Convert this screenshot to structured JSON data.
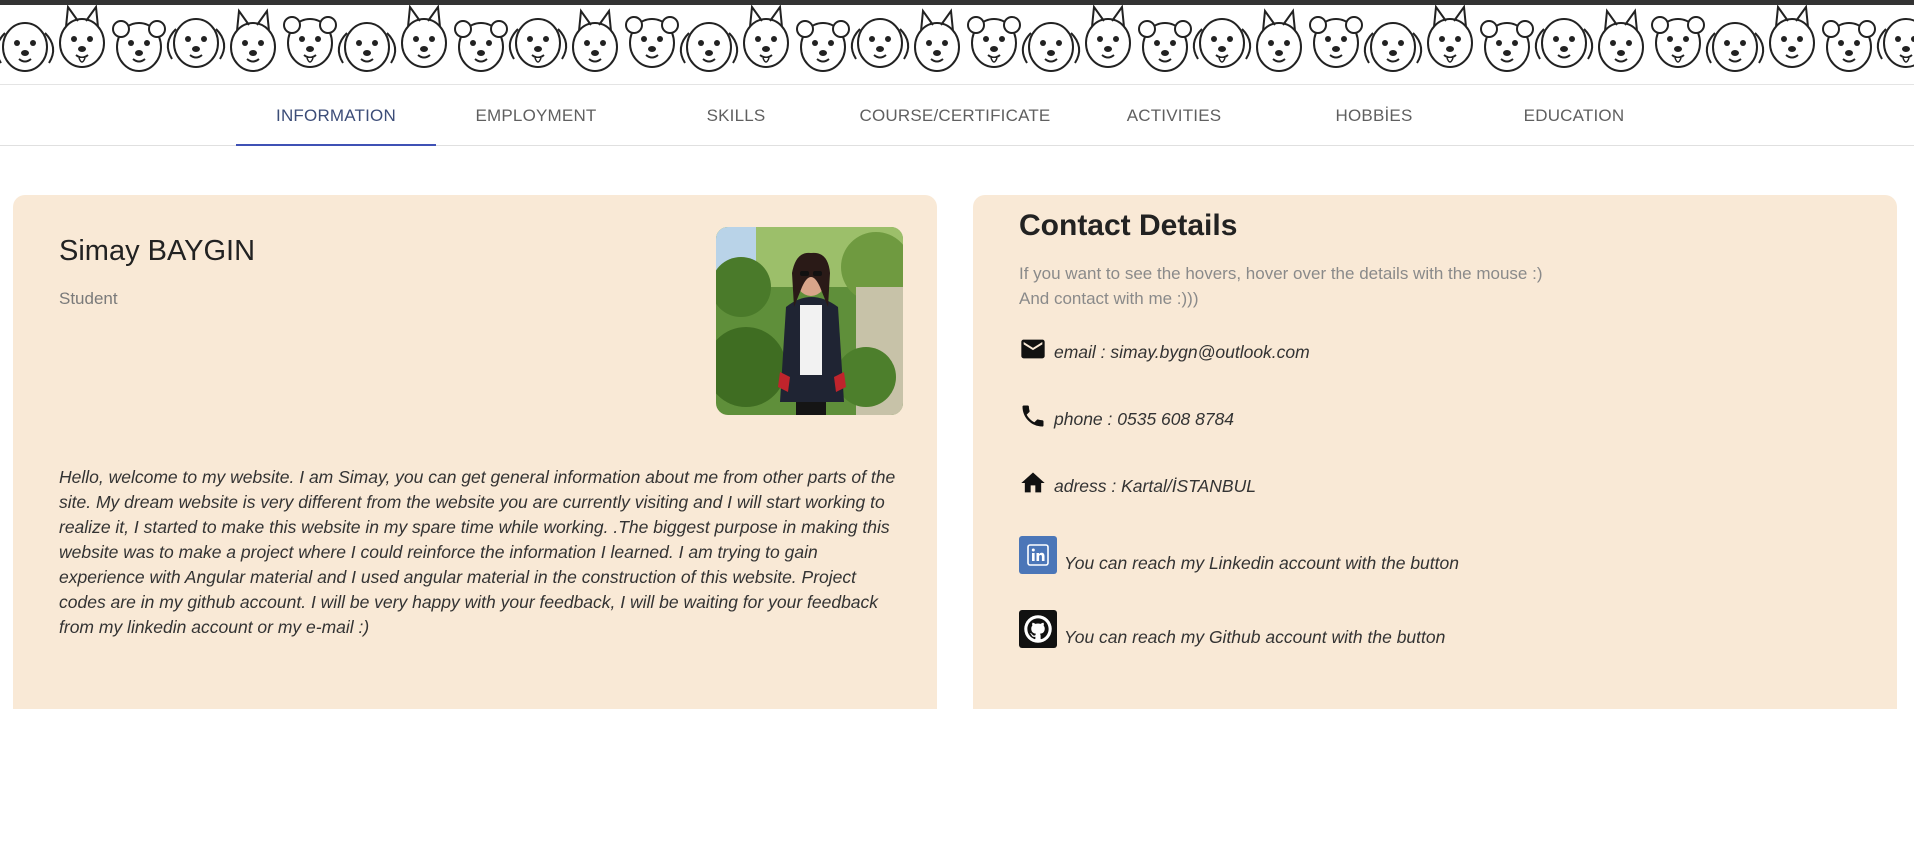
{
  "banner": {
    "icon": "dog-pattern-banner"
  },
  "nav": {
    "tabs": [
      {
        "label": "INFORMATION",
        "active": true
      },
      {
        "label": "EMPLOYMENT",
        "active": false
      },
      {
        "label": "SKILLS",
        "active": false
      },
      {
        "label": "COURSE/CERTIFICATE",
        "active": false
      },
      {
        "label": "ACTIVITIES",
        "active": false
      },
      {
        "label": "HOBBİES",
        "active": false
      },
      {
        "label": "EDUCATION",
        "active": false
      }
    ]
  },
  "profile": {
    "name": "Simay BAYGIN",
    "role": "Student",
    "photo_icon": "profile-photo",
    "bio": "Hello, welcome to my website. I am Simay, you can get general information about me from other parts of the site. My dream website is very different from the website you are currently visiting and I will start working to realize it, I started to make this website in my spare time while working. .The biggest purpose in making this website was to make a project where I could reinforce the information I learned. I am trying to gain experience with Angular material and I used angular material in the construction of this website. Project codes are in my github account. I will be very happy with your feedback, I will be waiting for your feedback from my linkedin account or my e-mail :)"
  },
  "contact": {
    "title": "Contact Details",
    "note_line1": "If you want to see the hovers, hover over the details with the mouse :)",
    "note_line2": "And contact with me :)))",
    "email": {
      "icon": "mail-icon",
      "text": "email : simay.bygn@outlook.com"
    },
    "phone": {
      "icon": "phone-icon",
      "text": "phone : 0535 608 8784"
    },
    "address": {
      "icon": "home-icon",
      "text": "adress : Kartal/İSTANBUL"
    },
    "linkedin": {
      "icon": "linkedin-icon",
      "text": "You can reach my Linkedin account with the button",
      "color": "#4b76b8"
    },
    "github": {
      "icon": "github-icon",
      "text": "You can reach my Github account with the button",
      "color": "#111111"
    }
  },
  "colors": {
    "card_bg": "#f9e9d6",
    "tab_indicator": "#3f51b5",
    "text_dark": "#222222",
    "text_muted": "#8a8a8a"
  }
}
